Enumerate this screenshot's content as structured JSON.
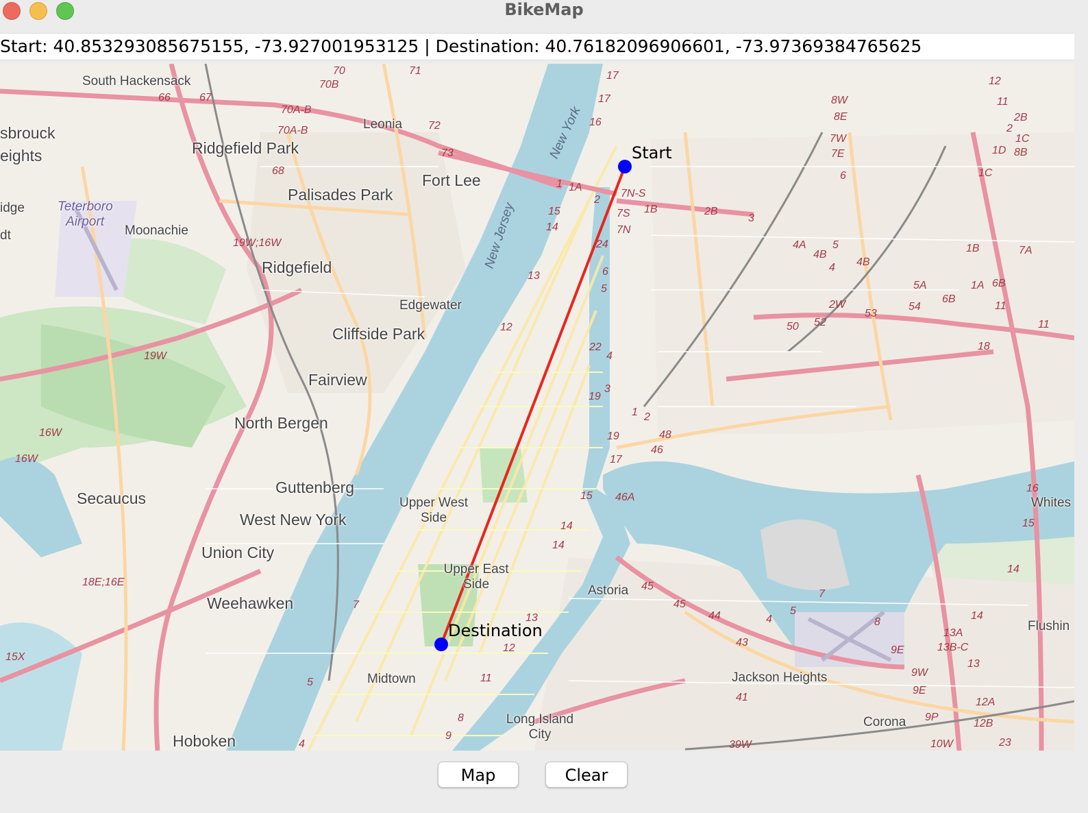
{
  "window": {
    "title": "BikeMap"
  },
  "coordinates": {
    "value": "Start: 40.853293085675155, -73.927001953125 | Destination: 40.76182096906601, -73.97369384765625"
  },
  "markers": {
    "start": {
      "label": "Start",
      "lat": 40.853293085675155,
      "lon": -73.927001953125,
      "color": "#0000ff"
    },
    "destination": {
      "label": "Destination",
      "lat": 40.76182096906601,
      "lon": -73.97369384765625,
      "color": "#0000ff"
    },
    "route_color": "#e8261c"
  },
  "map_labels": {
    "places": [
      "South Hackensack",
      "Ridgefield Park",
      "Palisades Park",
      "Fort Lee",
      "Leonia",
      "Ridgefield",
      "Cliffside Park",
      "Fairview",
      "North Bergen",
      "Guttenberg",
      "West New York",
      "Union City",
      "Weehawken",
      "Secaucus",
      "Hoboken",
      "Moonachie",
      "Edgewater",
      "Teterboro Airport",
      "Upper West Side",
      "Upper East Side",
      "Midtown",
      "Long Island City",
      "Astoria",
      "Jackson Heights",
      "Corona",
      "Flushin",
      "Whites",
      "sbrouck",
      "eights",
      "idge",
      "dt"
    ],
    "water": [
      "New York",
      "New Jersey"
    ],
    "routes": [
      "70",
      "70B",
      "71",
      "72",
      "73",
      "66",
      "67",
      "70A-B",
      "70A-B",
      "68",
      "19W;16W",
      "19W",
      "16W",
      "16W",
      "15X",
      "18E;16E",
      "17",
      "17",
      "16",
      "1",
      "1A",
      "2",
      "15",
      "14",
      "13",
      "12",
      "7N-S",
      "7S",
      "7N",
      "1B",
      "2B",
      "3",
      "24",
      "6",
      "5",
      "22",
      "4",
      "19",
      "3",
      "1",
      "2",
      "19",
      "17",
      "15",
      "14",
      "14",
      "13",
      "12",
      "11",
      "9",
      "8",
      "7",
      "5",
      "4",
      "48",
      "46",
      "46A",
      "45",
      "45",
      "44",
      "43",
      "41",
      "39W",
      "8W",
      "8E",
      "7W",
      "7E",
      "6",
      "4A",
      "4B",
      "5",
      "4",
      "4B",
      "2W",
      "52",
      "53",
      "54",
      "50",
      "5A",
      "6B",
      "1A",
      "6B",
      "11",
      "11",
      "1B",
      "7A",
      "12",
      "11",
      "2B",
      "1C",
      "1D",
      "8B",
      "2",
      "1C",
      "18",
      "16",
      "15",
      "14",
      "14",
      "13A",
      "13B-C",
      "13",
      "12A",
      "12B",
      "23",
      "10W",
      "9W",
      "9E",
      "9P",
      "7",
      "8",
      "9E",
      "5",
      "4"
    ]
  },
  "buttons": {
    "map": "Map",
    "clear": "Clear"
  }
}
